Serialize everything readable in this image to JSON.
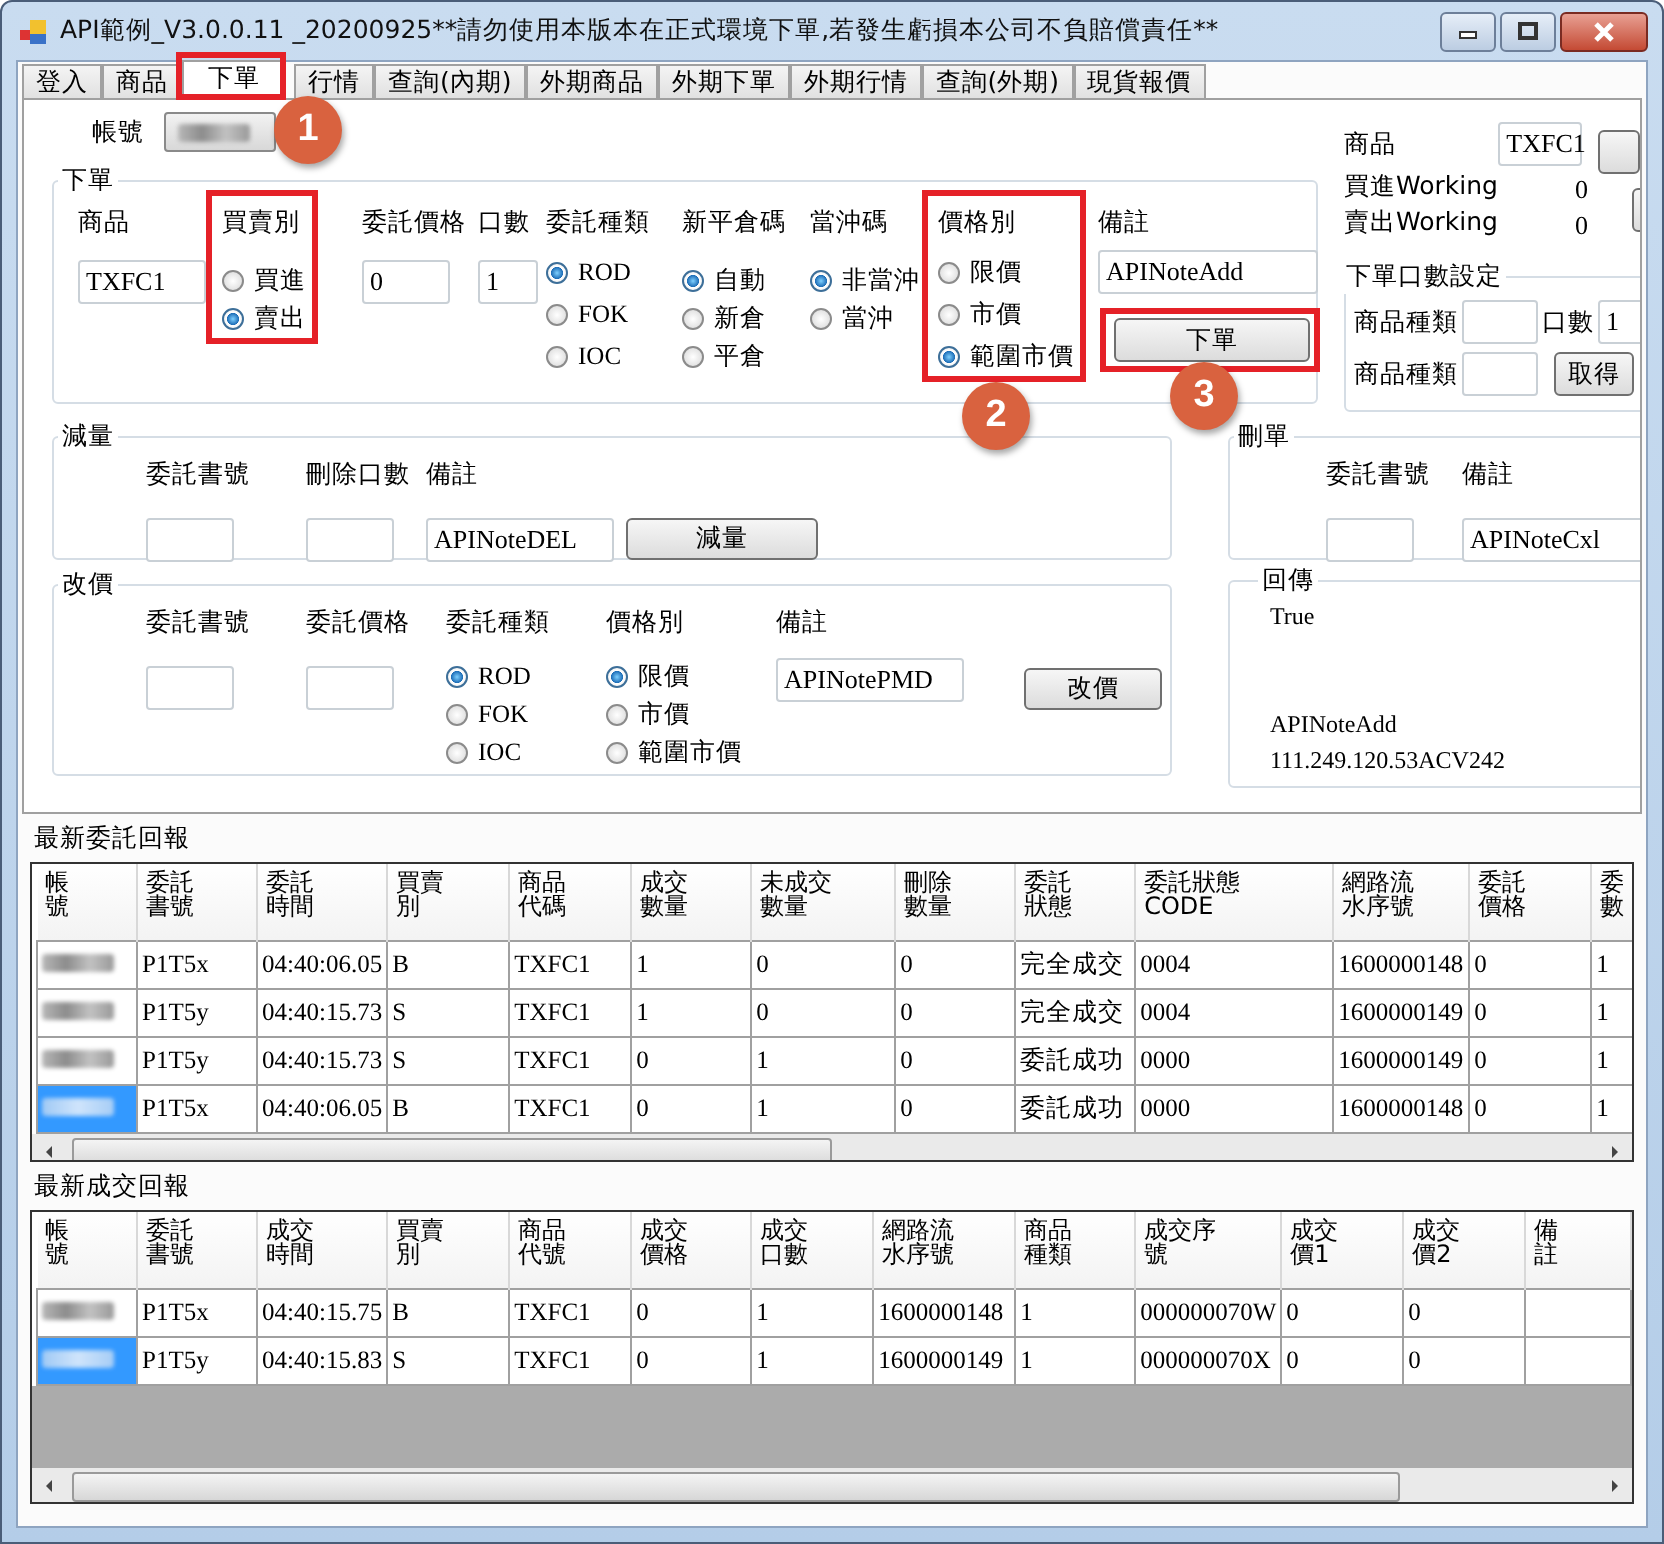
{
  "window": {
    "title": "API範例_V3.0.0.11 _20200925**請勿使用本版本在正式環境下單,若發生虧損本公司不負賠償責任**"
  },
  "tabs": [
    {
      "label": "登入",
      "selected": false
    },
    {
      "label": "商品",
      "selected": false
    },
    {
      "label": "下單",
      "selected": true,
      "highlighted": true,
      "callout": "1"
    },
    {
      "label": "行情",
      "selected": false
    },
    {
      "label": "查詢(內期)",
      "selected": false
    },
    {
      "label": "外期商品",
      "selected": false
    },
    {
      "label": "外期下單",
      "selected": false
    },
    {
      "label": "外期行情",
      "selected": false
    },
    {
      "label": "查詢(外期)",
      "selected": false
    },
    {
      "label": "現貨報價",
      "selected": false
    }
  ],
  "account": {
    "label": "帳號"
  },
  "order": {
    "title": "下單",
    "fields": [
      {
        "kind": "text",
        "label": "商品",
        "value": "TXFC1"
      },
      {
        "kind": "radio",
        "label": "買賣別",
        "highlighted": true,
        "options": [
          {
            "label": "買進",
            "selected": false
          },
          {
            "label": "賣出",
            "selected": true
          }
        ]
      },
      {
        "kind": "text",
        "label": "委託價格",
        "value": "0"
      },
      {
        "kind": "text",
        "label": "口數",
        "value": "1"
      },
      {
        "kind": "radio",
        "label": "委託種類",
        "options": [
          {
            "label": "ROD",
            "selected": true
          },
          {
            "label": "FOK",
            "selected": false
          },
          {
            "label": "IOC",
            "selected": false
          }
        ]
      },
      {
        "kind": "radio",
        "label": "新平倉碼",
        "options": [
          {
            "label": "自動",
            "selected": true
          },
          {
            "label": "新倉",
            "selected": false
          },
          {
            "label": "平倉",
            "selected": false
          }
        ]
      },
      {
        "kind": "radio",
        "label": "當沖碼",
        "options": [
          {
            "label": "非當沖",
            "selected": true
          },
          {
            "label": "當沖",
            "selected": false
          }
        ]
      },
      {
        "kind": "radio",
        "label": "價格別",
        "highlighted": true,
        "callout": "2",
        "options": [
          {
            "label": "限價",
            "selected": false
          },
          {
            "label": "市價",
            "selected": false
          },
          {
            "label": "範圍市價",
            "selected": true
          }
        ]
      },
      {
        "kind": "text",
        "label": "備註",
        "value": "APINoteAdd"
      }
    ],
    "button": {
      "label": "下單",
      "highlighted": true,
      "callout": "3"
    }
  },
  "side_panel": {
    "product": {
      "label": "商品",
      "value": "TXFC1"
    },
    "buy_working": {
      "label": "買進Working",
      "value": "0"
    },
    "sell_working": {
      "label": "賣出Working",
      "value": "0"
    },
    "qty_setting": {
      "title": "下單口數設定",
      "product_type_label": "商品種類",
      "qty_label": "口數",
      "qty_value": "1",
      "product_type_label_2": "商品種類",
      "button": "取得"
    }
  },
  "reduce": {
    "title": "減量",
    "fields": [
      {
        "kind": "text",
        "label": "委託書號"
      },
      {
        "kind": "text",
        "label": "刪除口數"
      },
      {
        "kind": "text",
        "label": "備註",
        "value": "APINoteDEL"
      }
    ],
    "button": {
      "label": "減量"
    }
  },
  "modify": {
    "title": "改價",
    "fields": [
      {
        "kind": "text",
        "label": "委託書號"
      },
      {
        "kind": "text",
        "label": "委託價格"
      },
      {
        "kind": "radio",
        "label": "委託種類",
        "options": [
          {
            "label": "ROD",
            "selected": true
          },
          {
            "label": "FOK",
            "selected": false
          },
          {
            "label": "IOC",
            "selected": false
          }
        ]
      },
      {
        "kind": "radio",
        "label": "價格別",
        "options": [
          {
            "label": "限價",
            "selected": true
          },
          {
            "label": "市價",
            "selected": false
          },
          {
            "label": "範圍市價",
            "selected": false
          }
        ]
      },
      {
        "kind": "text",
        "label": "備註",
        "value": "APINotePMD"
      }
    ],
    "button": {
      "label": "改價"
    }
  },
  "cancel": {
    "title": "刪單",
    "fields": [
      {
        "kind": "text",
        "label": "委託書號"
      },
      {
        "kind": "text",
        "label": "備註",
        "value": "APINoteCxl"
      }
    ]
  },
  "response": {
    "title": "回傳",
    "lines": [
      "True",
      "APINoteAdd",
      "111.249.120.53ACV242"
    ]
  },
  "orders_report": {
    "title": "最新委託回報",
    "columns": [
      "帳號",
      "委託書號",
      "委託時間",
      "買賣別",
      "商品代碼",
      "成交數量",
      "未成交數量",
      "刪除數量",
      "委託狀態",
      "委託狀態CODE",
      "網路流水序號",
      "委託價格",
      "委數"
    ],
    "rows": [
      {
        "selected": false,
        "cells": [
          "",
          "P1T5x",
          "04:40:06.05",
          "B",
          "TXFC1",
          "1",
          "0",
          "0",
          "完全成交",
          "0004",
          "1600000148",
          "0",
          "1"
        ]
      },
      {
        "selected": false,
        "cells": [
          "",
          "P1T5y",
          "04:40:15.73",
          "S",
          "TXFC1",
          "1",
          "0",
          "0",
          "完全成交",
          "0004",
          "1600000149",
          "0",
          "1"
        ]
      },
      {
        "selected": false,
        "cells": [
          "",
          "P1T5y",
          "04:40:15.73",
          "S",
          "TXFC1",
          "0",
          "1",
          "0",
          "委託成功",
          "0000",
          "1600000149",
          "0",
          "1"
        ]
      },
      {
        "selected": true,
        "cells": [
          "",
          "P1T5x",
          "04:40:06.05",
          "B",
          "TXFC1",
          "0",
          "1",
          "0",
          "委託成功",
          "0000",
          "1600000148",
          "0",
          "1"
        ]
      }
    ]
  },
  "trades_report": {
    "title": "最新成交回報",
    "columns": [
      "帳號",
      "委託書號",
      "成交時間",
      "買賣別",
      "商品代號",
      "成交價格",
      "成交口數",
      "網路流水序號",
      "商品種類",
      "成交序號",
      "成交價1",
      "成交價2",
      "備註"
    ],
    "rows": [
      {
        "selected": false,
        "cells": [
          "",
          "P1T5x",
          "04:40:15.75",
          "B",
          "TXFC1",
          "0",
          "1",
          "1600000148",
          "1",
          "000000070W",
          "0",
          "0",
          ""
        ]
      },
      {
        "selected": true,
        "cells": [
          "",
          "P1T5y",
          "04:40:15.83",
          "S",
          "TXFC1",
          "0",
          "1",
          "1600000149",
          "1",
          "000000070X",
          "0",
          "0",
          ""
        ]
      }
    ]
  }
}
